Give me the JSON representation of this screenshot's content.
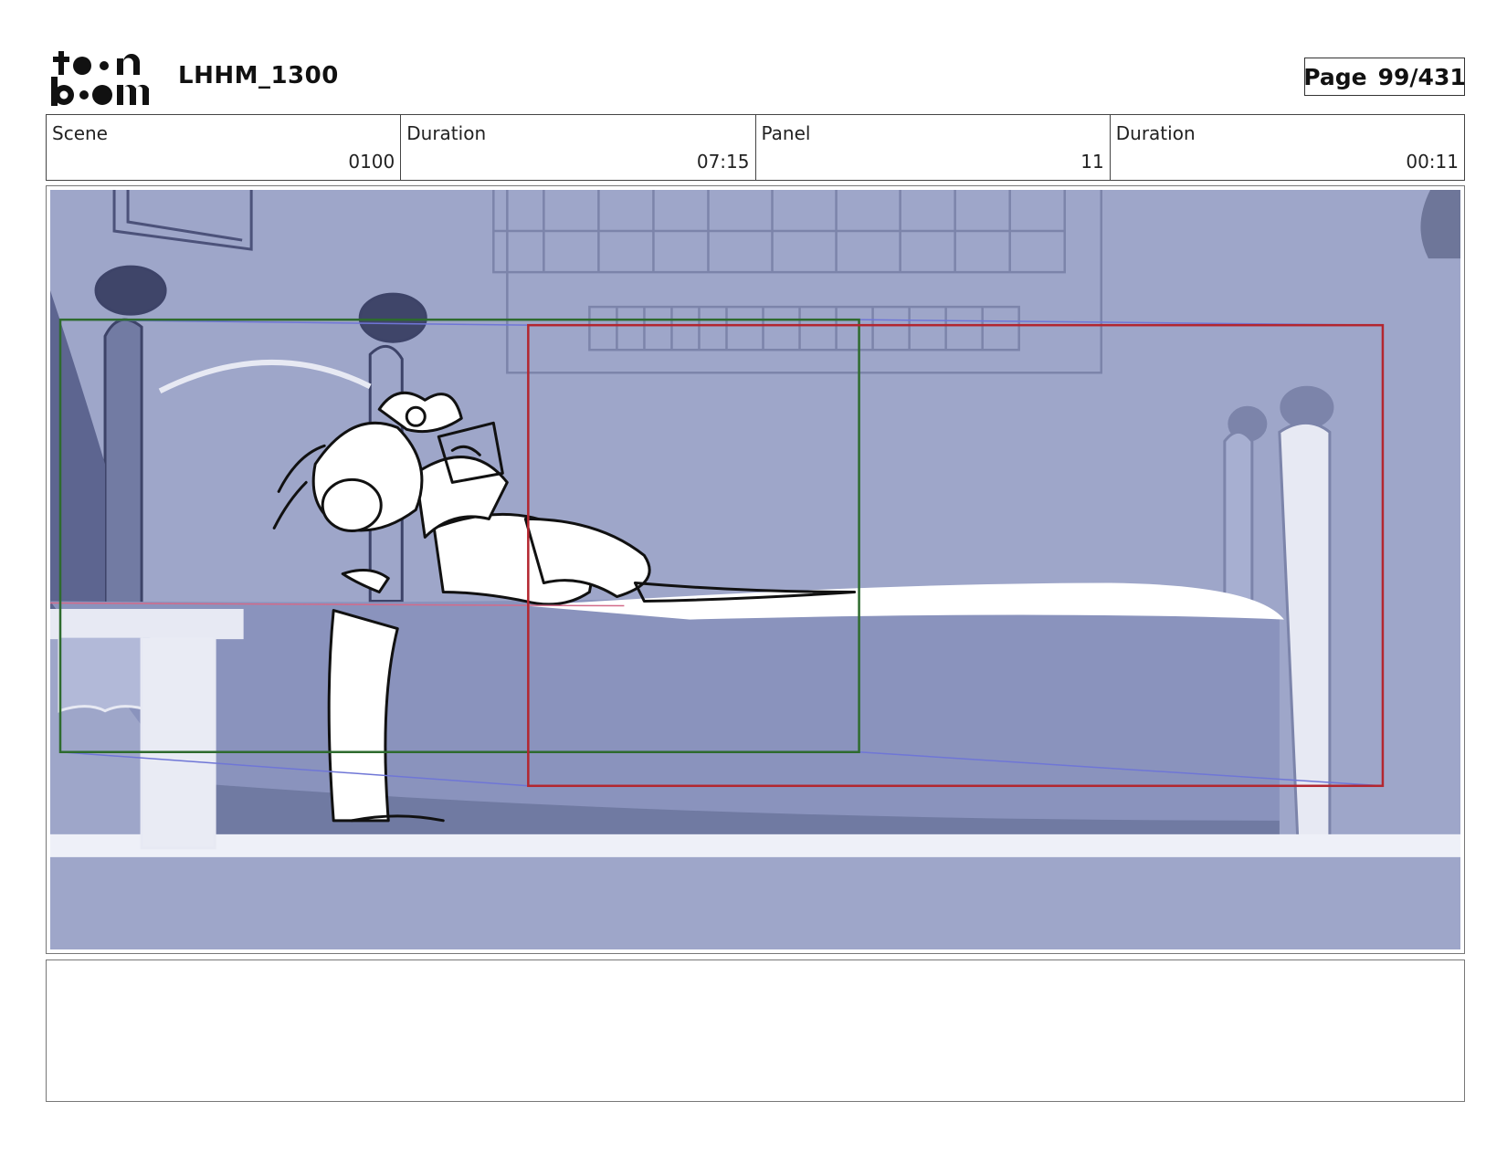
{
  "header": {
    "logo_text_top": "toon",
    "logo_text_bottom": "boom",
    "project": "LHHM_1300",
    "page_label": "Page",
    "page_value": "99/431"
  },
  "info": [
    {
      "label": "Scene",
      "value": "0100"
    },
    {
      "label": "Duration",
      "value": "07:15"
    },
    {
      "label": "Panel",
      "value": "11"
    },
    {
      "label": "Duration",
      "value": "00:11"
    }
  ],
  "panel": {
    "background_color": "#9ea6c9",
    "camera_start_color": "#2e6b2e",
    "camera_end_color": "#b3262f"
  },
  "notes": ""
}
